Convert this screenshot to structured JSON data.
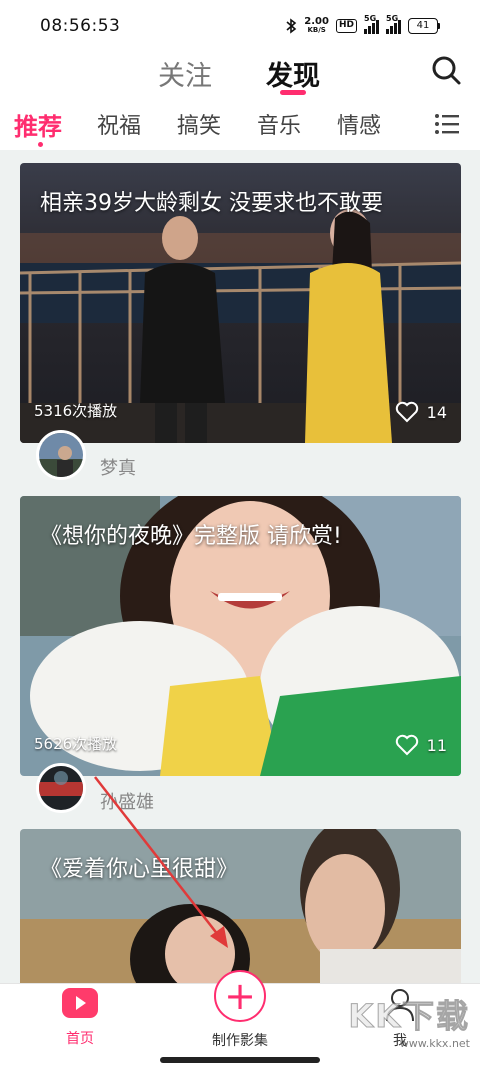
{
  "status_bar": {
    "time": "08:56:53",
    "net_speed": "2.00",
    "net_unit": "KB/S",
    "hd": "HD",
    "sim1": "5G",
    "sim2": "5G",
    "battery": "41"
  },
  "header": {
    "tab_follow": "关注",
    "tab_discover": "发现",
    "active_tab": "发现"
  },
  "categories": {
    "items": [
      "推荐",
      "祝福",
      "搞笑",
      "音乐",
      "情感"
    ],
    "active": "推荐"
  },
  "feed": [
    {
      "title": "相亲39岁大龄剩女 没要求也不敢要",
      "plays": "5316次播放",
      "likes": "14",
      "author": "梦真"
    },
    {
      "title": "《想你的夜晚》完整版 请欣赏!",
      "plays": "5626次播放",
      "likes": "11",
      "author": "孙盛雄"
    },
    {
      "title": "《爱着你心里很甜》"
    }
  ],
  "bottom_nav": {
    "home": "首页",
    "create": "制作影集",
    "me": "我"
  },
  "watermark": {
    "brand": "KK下载",
    "url": "www.kkx.net"
  },
  "colors": {
    "accent": "#ff2d6f",
    "background": "#eef2f1"
  }
}
